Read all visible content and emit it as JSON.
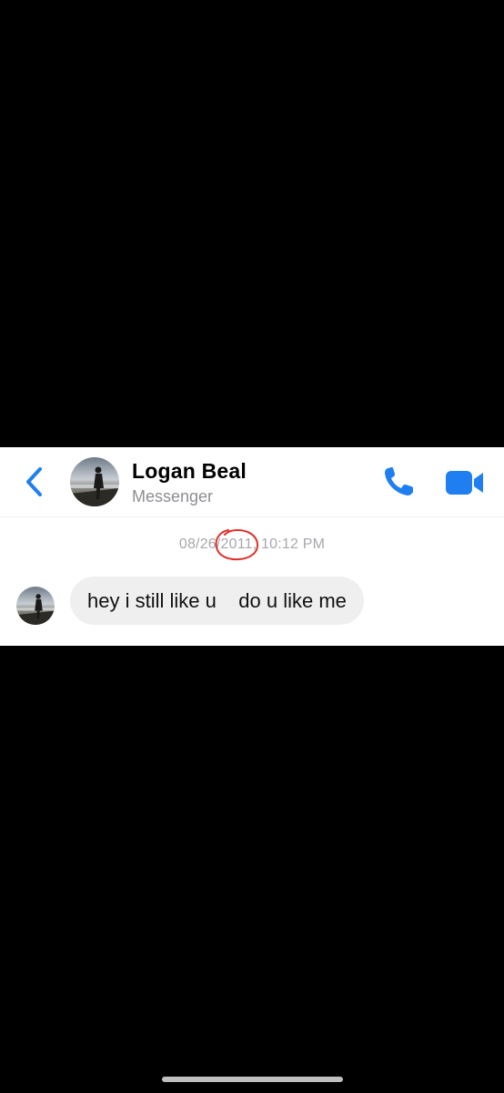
{
  "header": {
    "contact_name": "Logan Beal",
    "subtitle": "Messenger",
    "back_icon": "chevron-left-icon",
    "call_icon": "phone-icon",
    "video_icon": "video-camera-icon",
    "accent_color": "#1f7ff0"
  },
  "conversation": {
    "timestamp": "08/26/2011, 10:12 PM",
    "annotation_color": "#e0302a",
    "messages": [
      {
        "sender": "Logan Beal",
        "text": "hey i still like u    do u like me"
      }
    ]
  }
}
